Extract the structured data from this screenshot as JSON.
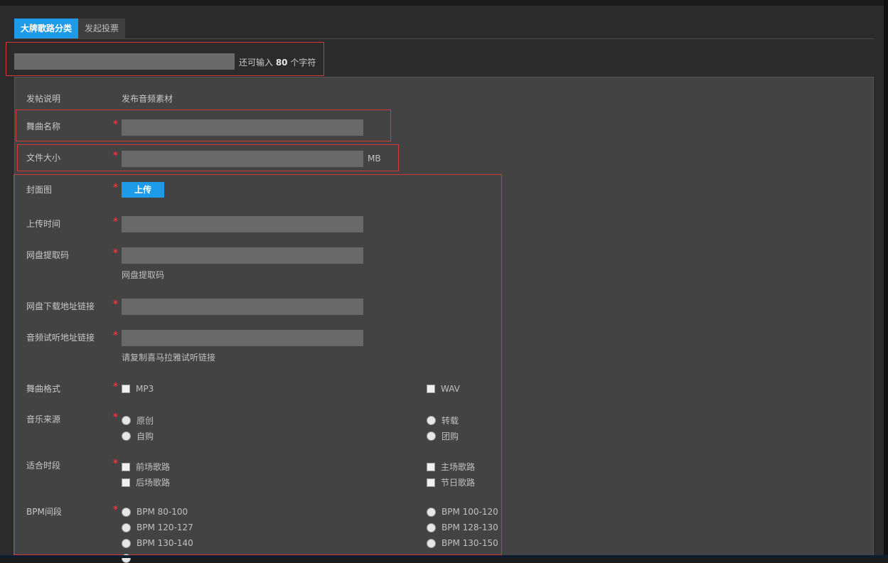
{
  "tabs": [
    {
      "label": "大牌歌路分类"
    },
    {
      "label": "发起投票"
    }
  ],
  "title_counter": {
    "prefix": "还可输入 ",
    "count": "80",
    "suffix": " 个字符"
  },
  "form": {
    "post_note": {
      "label": "发帖说明",
      "value": "发布音频素材"
    },
    "song_name": {
      "label": "舞曲名称",
      "value": ""
    },
    "file_size": {
      "label": "文件大小",
      "value": "",
      "unit": "MB"
    },
    "cover": {
      "label": "封面图",
      "button": "上传"
    },
    "upload_time": {
      "label": "上传时间",
      "value": ""
    },
    "pan_code": {
      "label": "网盘提取码",
      "value": "",
      "hint": "网盘提取码"
    },
    "pan_link": {
      "label": "网盘下载地址链接",
      "value": ""
    },
    "audition_link": {
      "label": "音频试听地址链接",
      "value": "",
      "hint": "请复制喜马拉雅试听链接"
    },
    "format": {
      "label": "舞曲格式",
      "options": [
        "MP3",
        "WAV"
      ]
    },
    "source": {
      "label": "音乐来源",
      "options": [
        "原创",
        "转载",
        "自购",
        "团购"
      ]
    },
    "timing": {
      "label": "适合时段",
      "options": [
        "前场歌路",
        "主场歌路",
        "后场歌路",
        "节日歌路"
      ]
    },
    "bpm": {
      "label": "BPM间段",
      "options": [
        "BPM 80-100",
        "BPM 100-120",
        "BPM 120-127",
        "BPM 128-130",
        "BPM 130-140",
        "BPM 130-150"
      ]
    }
  },
  "required_mark": "*",
  "colors": {
    "accent": "#1e9be8",
    "required": "#e03c3c",
    "highlight_border": "#d23a3a"
  }
}
